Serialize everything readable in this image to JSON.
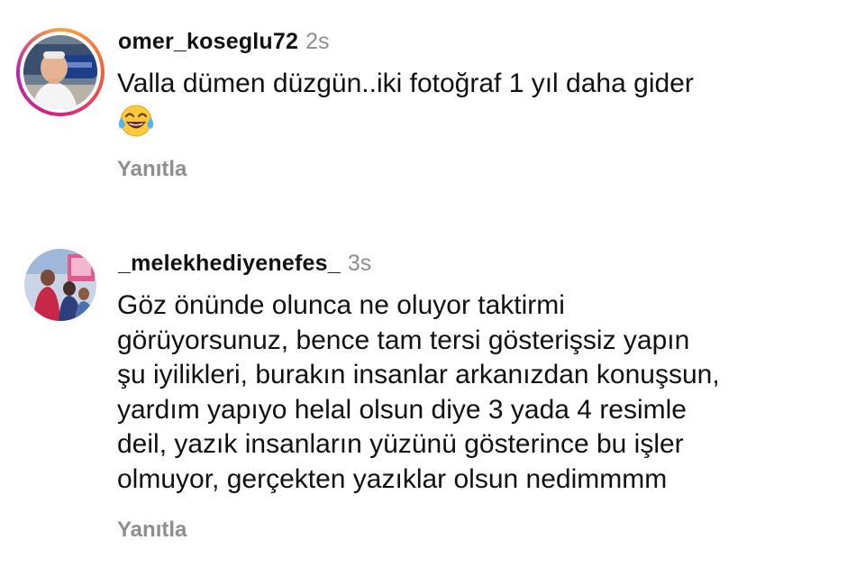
{
  "comments": [
    {
      "username": "omer_koseglu72",
      "time": "2s",
      "lines": [
        "Valla dümen düzgün..iki fotoğraf 1 yıl daha gider"
      ],
      "emoji": "face-with-tears-of-joy-icon",
      "reply_label": "Yanıtla"
    },
    {
      "username": "_melekhediyenefes_",
      "time": "3s",
      "lines": [
        "Göz önünde olunca ne oluyor taktirmi",
        "görüyorsunuz, bence tam tersi gösterişsiz yapın",
        "şu iyilikleri, burakın insanlar arkanızdan konuşsun,",
        "yardım yapıyo helal olsun diye 3 yada 4 resimle",
        "deil, yazık insanların yüzünü gösterince bu işler",
        "olmuyor, gerçekten yazıklar olsun nedimmmm"
      ],
      "reply_label": "Yanıtla"
    }
  ],
  "colors": {
    "text": "#111111",
    "muted": "#8e8e8e",
    "story_ring": [
      "#f9a43a",
      "#f2603c",
      "#d9237c",
      "#b32aa9"
    ]
  }
}
